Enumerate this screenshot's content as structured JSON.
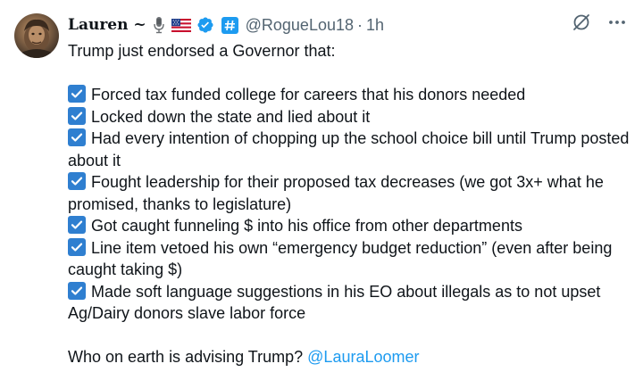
{
  "tweet": {
    "display_name": "Lauren ~",
    "handle": "@RogueLou18",
    "separator": "·",
    "time": "1h",
    "intro": "Trump just endorsed a Governor that:",
    "items": [
      "Forced tax funded college for careers that his donors needed",
      "Locked down the state and lied about it",
      "Had every intention of chopping up the school choice bill until Trump posted about it",
      "Fought leadership for their proposed tax decreases (we got 3x+ what he promised, thanks to legislature)",
      "Got caught funneling $ into his office from other departments",
      "Line item vetoed his own “emergency budget reduction” (even after being caught taking $)",
      "Made soft language suggestions in his EO about illegals as to not upset Ag/Dairy donors slave labor force"
    ],
    "closing": "Who on earth is advising Trump?",
    "mention": "@LauraLoomer"
  },
  "icons": {
    "name_emojis": [
      "microphone-icon",
      "us-flag-icon"
    ],
    "badges": [
      "verified-icon",
      "hashtag-badge-icon"
    ],
    "actions": [
      "grok-icon",
      "more-icon"
    ],
    "item_marker": "checkbox-icon"
  },
  "colors": {
    "text": "#0f1419",
    "secondary": "#536471",
    "link": "#1d9bf0",
    "verified": "#1d9bf0",
    "checkbox": "#2f7fd0"
  }
}
